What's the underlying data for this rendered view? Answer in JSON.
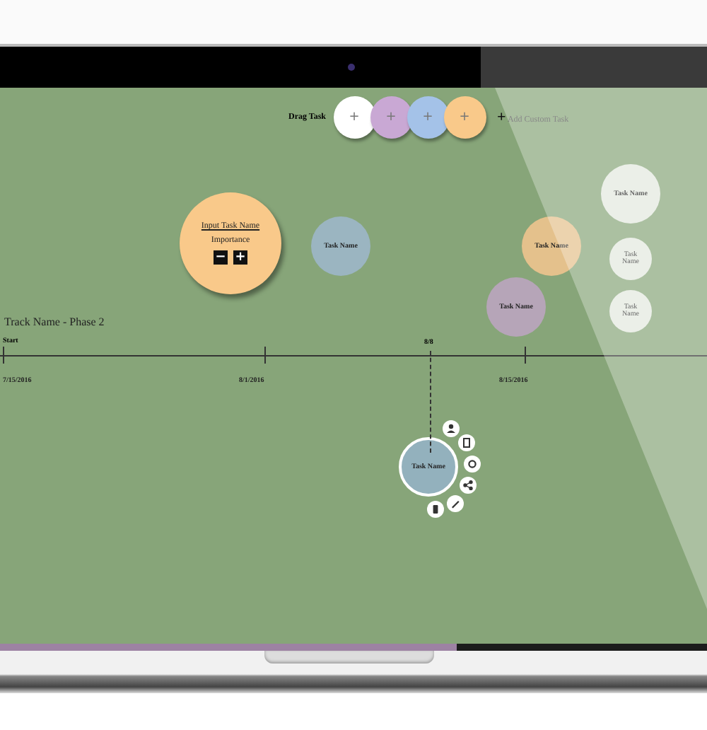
{
  "toolbar": {
    "drag_label": "Drag Task",
    "swatches": [
      {
        "color": "#ffffff",
        "symbol": "+"
      },
      {
        "color": "#c9a8d4",
        "symbol": "+"
      },
      {
        "color": "#a4c2e8",
        "symbol": "+"
      },
      {
        "color": "#f9c98a",
        "symbol": "+"
      }
    ],
    "add_symbol": "+",
    "add_label": "Add Custom Task"
  },
  "tasks": [
    {
      "kind": "editor",
      "color": "#f9c98a",
      "name": "Input Task Name",
      "importance_label": "Importance",
      "minus": "−",
      "plus": "+"
    },
    {
      "kind": "bubble",
      "color": "#9bb5c1",
      "name": "Task Name"
    },
    {
      "kind": "bubble",
      "color": "#e4c18c",
      "name": "Task Name"
    },
    {
      "kind": "bubble",
      "color": "#b6a5b8",
      "name": "Task Name"
    },
    {
      "kind": "bubble",
      "color": "#e3e9df",
      "name": "Task Name"
    },
    {
      "kind": "bubble",
      "color": "#e3e9df",
      "name": "Task Name"
    },
    {
      "kind": "bubble",
      "color": "#e3e9df",
      "name": "Task Name"
    },
    {
      "kind": "selected",
      "color": "#93b1bd",
      "name": "Task Name"
    }
  ],
  "track": {
    "title": "Track Name - Phase 2",
    "start_label": "Start",
    "dates": [
      "7/15/2016",
      "8/1/2016",
      "8/15/2016"
    ],
    "today_label": "8/8"
  },
  "progress": {
    "level": 0.645
  }
}
